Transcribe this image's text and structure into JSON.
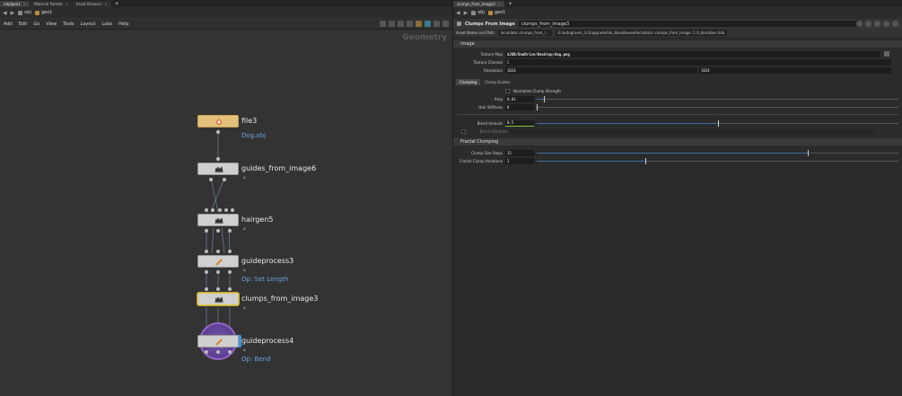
{
  "left_tabs": [
    "/obj/geo1",
    "Material Palette",
    "Asset Browser"
  ],
  "right_tabs": [
    "clumps_from_image3"
  ],
  "left_path": {
    "level1": "obj",
    "level2": "geo1"
  },
  "right_path": {
    "level1": "obj",
    "level2": "geo1"
  },
  "menu": [
    "Add",
    "Edit",
    "Go",
    "View",
    "Tools",
    "Layout",
    "Labs",
    "Help"
  ],
  "context_label": "Geometry",
  "nodes": [
    {
      "name": "file3",
      "sub": "Dog.obj"
    },
    {
      "name": "guides_from_image6",
      "sub": ""
    },
    {
      "name": "hairgen5",
      "sub": ""
    },
    {
      "name": "guideprocess3",
      "sub": "Op: Set Length"
    },
    {
      "name": "clumps_from_image3",
      "sub": ""
    },
    {
      "name": "guideprocess4",
      "sub": "Op: Bend"
    }
  ],
  "params": {
    "type_label": "Clumps From Image",
    "node_name": "clumps_from_image3",
    "asset_tab": "Asset Name and Path",
    "asset_name": "localdata::clumps_from_i...",
    "asset_path": "E:/autogroom_3.0/upgrade/lda_blackboxed/localdata::clumps_from_image::1.0_blackbox.hda",
    "image_section": "Image",
    "texture_map_label": "Texture Map",
    "texture_map_value": "$JOB/OneDrive/Desktop/dog.png",
    "texture_channel_label": "Texture Channel",
    "texture_channel_value": "C",
    "resolution_label": "Resolution",
    "resolution_x": "1024",
    "resolution_y": "1024",
    "tab_clumping": "Clumping",
    "tab_clump_guides": "Clump Guides",
    "normalize_label": "Normalize Clump Strength",
    "amp_label": "Amp",
    "amp_value": "0.01",
    "hair_stiffness_label": "Hair Stiffness",
    "hair_stiffness_value": "0",
    "blend_amount_label": "Blend Amount",
    "blend_amount_value": "0.5",
    "blend_attribute_label": "Blend Attribute",
    "fractal_section": "Fractal Clumping",
    "clump_size_steps_label": "Clump Size Steps",
    "clump_size_steps_value": "15",
    "fractal_iterations_label": "Fractal Clump Iterations",
    "fractal_iterations_value": "3"
  },
  "sliders": {
    "amp": 0.02,
    "hair_stiffness": 0.0,
    "blend_amount": 0.5,
    "clump_size_steps": 0.75,
    "fractal_iterations": 0.3
  },
  "colors": {
    "accent": "#3d6fa8",
    "file_node": "#e3c17b",
    "selected_outline": "#e0c84a",
    "subtext": "#6ba3e0"
  }
}
